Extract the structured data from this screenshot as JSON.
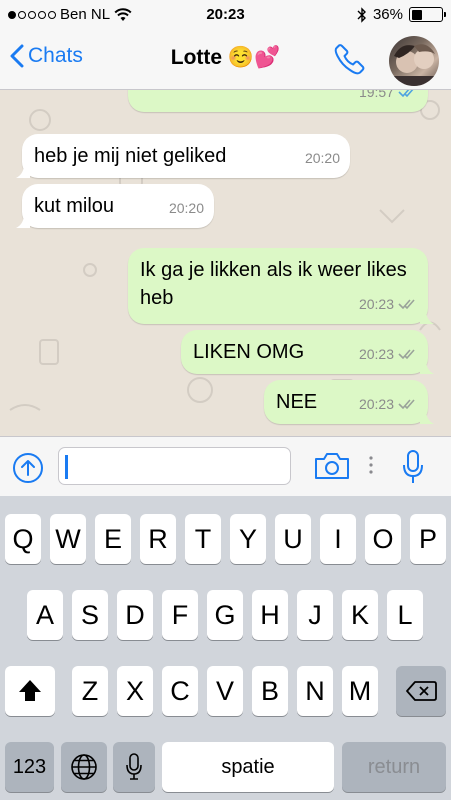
{
  "status_bar": {
    "carrier": "Ben NL",
    "time": "20:23",
    "battery_percent": "36%",
    "battery_level": 0.36
  },
  "nav": {
    "back_label": "Chats",
    "contact_name": "Lotte ☺️💕"
  },
  "messages": [
    {
      "direction": "out",
      "text": "",
      "time": "19:57",
      "ticks": "read"
    },
    {
      "direction": "in",
      "text": "heb je mij niet geliked",
      "time": "20:20"
    },
    {
      "direction": "in",
      "text": "kut milou",
      "time": "20:20"
    },
    {
      "direction": "out",
      "text": "Ik ga je likken als ik weer likes heb",
      "time": "20:23",
      "ticks": "delivered"
    },
    {
      "direction": "out",
      "text": "LIKEN OMG",
      "time": "20:23",
      "ticks": "delivered"
    },
    {
      "direction": "out",
      "text": "NEE",
      "time": "20:23",
      "ticks": "delivered"
    }
  ],
  "input": {
    "value": ""
  },
  "keyboard": {
    "row1": [
      "Q",
      "W",
      "E",
      "R",
      "T",
      "Y",
      "U",
      "I",
      "O",
      "P"
    ],
    "row2": [
      "A",
      "S",
      "D",
      "F",
      "G",
      "H",
      "J",
      "K",
      "L"
    ],
    "row3": [
      "Z",
      "X",
      "C",
      "V",
      "B",
      "N",
      "M"
    ],
    "numbers_label": "123",
    "space_label": "spatie",
    "return_label": "return"
  },
  "colors": {
    "accent": "#1a7bf2",
    "bubble_out": "#dcf8c6",
    "bubble_in": "#ffffff",
    "read_ticks": "#4fa3e0"
  }
}
